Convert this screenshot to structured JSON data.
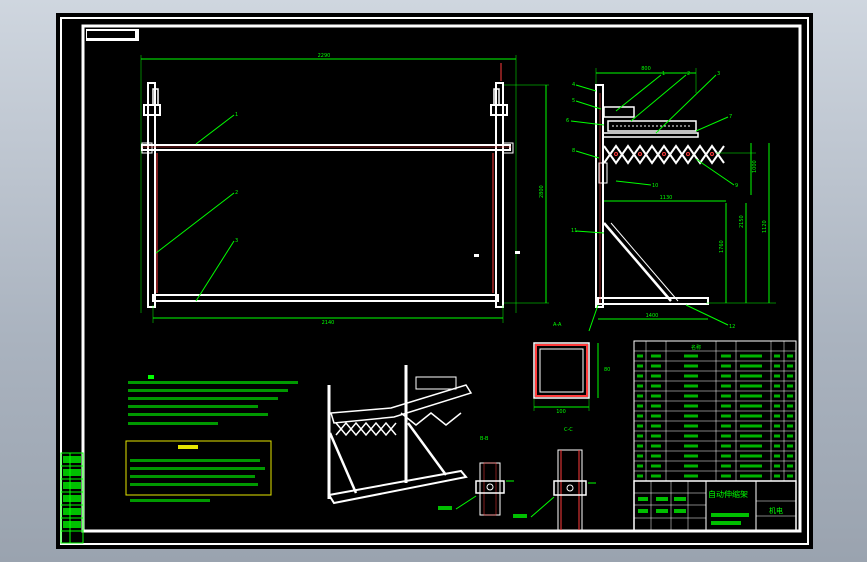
{
  "colors": {
    "background": "#000000",
    "frame": "#ffffff",
    "dimension": "#00ff00",
    "centerline": "#00e0e0",
    "hidden": "#ff3b3b",
    "viewer_chrome": "#aab3bf"
  },
  "drawing": {
    "front_view": {
      "overall_width_dim": "2290",
      "inner_width_dim": "2140",
      "height_dim": "2800",
      "balloons": [
        "1",
        "2",
        "3"
      ]
    },
    "side_view": {
      "top_dim": "800",
      "mid_dim": "1130",
      "bottom_dim": "1400",
      "right_dims": [
        "1000",
        "1120"
      ],
      "left_dims": [
        "1760",
        "2150"
      ],
      "balloons": [
        "1",
        "2",
        "3",
        "4",
        "5",
        "6",
        "7",
        "8",
        "9",
        "10",
        "11",
        "12"
      ]
    },
    "section_view": {
      "dim_bottom": "100",
      "dim_right": "80",
      "section_mark": "A-A"
    },
    "detail_labels": [
      "B-B",
      "C-C"
    ]
  },
  "bom": {
    "header": "名称",
    "rows": 14
  },
  "title_block": {
    "title": "自动伸缩架",
    "company": "机电"
  },
  "revision_block": {
    "rows": 7
  }
}
